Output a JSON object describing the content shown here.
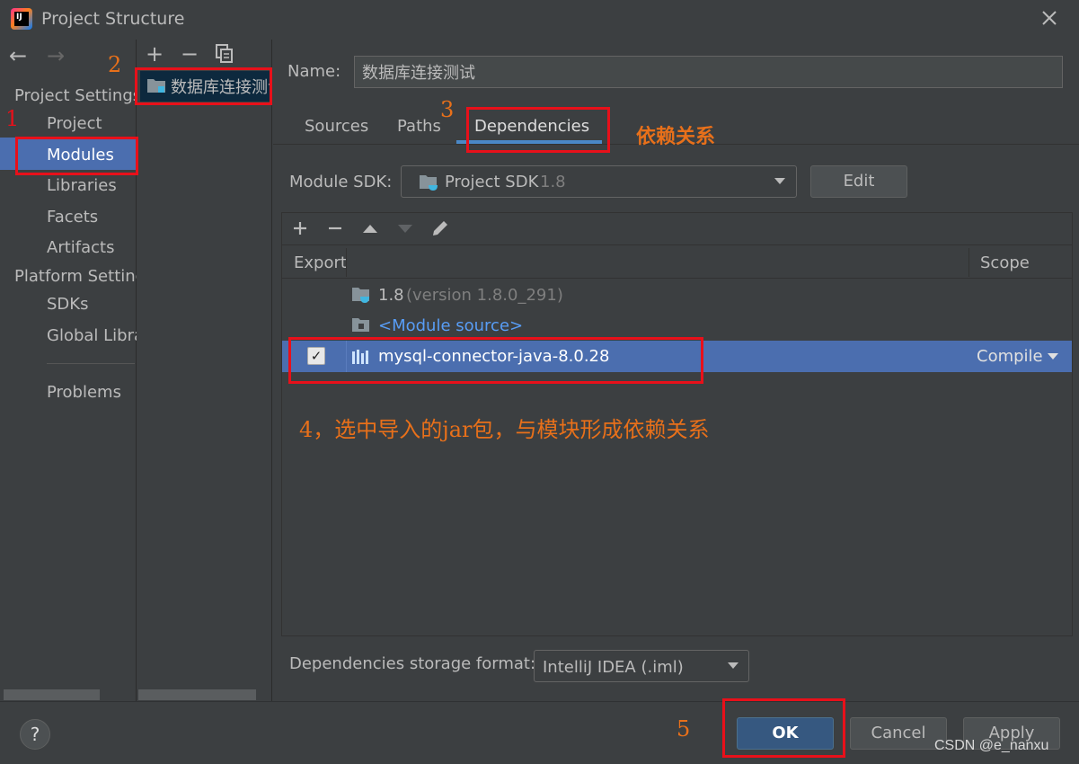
{
  "window": {
    "title": "Project Structure"
  },
  "sidebar": {
    "project_settings_header": "Project Settings",
    "project_items": [
      "Project",
      "Modules",
      "Libraries",
      "Facets",
      "Artifacts"
    ],
    "platform_settings_header": "Platform Settings",
    "platform_items": [
      "SDKs",
      "Global Libraries"
    ],
    "problems": "Problems"
  },
  "modules": {
    "toolbar": [
      "+",
      "−"
    ],
    "items": [
      "数据库连接测试"
    ]
  },
  "main": {
    "name_label": "Name:",
    "name_value": "数据库连接测试",
    "tabs": [
      "Sources",
      "Paths",
      "Dependencies"
    ],
    "active_tab": "Dependencies",
    "sdk_label": "Module SDK:",
    "sdk_value": "Project SDK",
    "sdk_version": "1.8",
    "edit_button": "Edit",
    "dependencies": {
      "columns": {
        "export": "Export",
        "scope": "Scope"
      },
      "rows": [
        {
          "name": "1.8",
          "detail": "(version 1.8.0_291)"
        },
        {
          "name": "<Module source>"
        },
        {
          "name": "mysql-connector-java-8.0.28",
          "checked": true,
          "scope": "Compile"
        }
      ]
    },
    "storage_format_label": "Dependencies storage format:",
    "storage_format_value": "IntelliJ IDEA (.iml)"
  },
  "footer": {
    "help": "?",
    "ok": "OK",
    "cancel": "Cancel",
    "apply": "Apply"
  },
  "annotations": {
    "n1": "1",
    "n2": "2",
    "n3": "3",
    "n5": "5",
    "dep_note": "依赖关系",
    "step4": "4，选中导入的jar包，与模块形成依赖关系"
  },
  "watermark": "CSDN @e_nanxu",
  "colors": {
    "selection": "#4b6eaf",
    "accent": "#4a88c7",
    "annotation_red": "#e8101a",
    "annotation_orange": "#e8701a"
  }
}
